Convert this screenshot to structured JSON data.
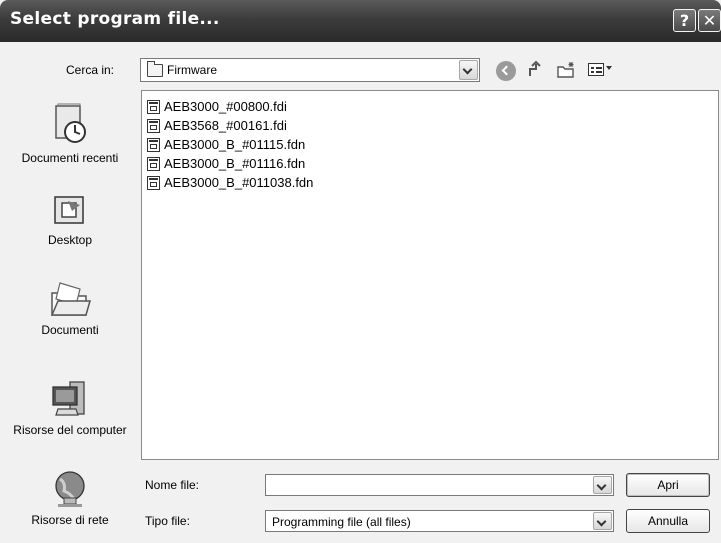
{
  "window": {
    "title": "Select program file...",
    "help_glyph": "?",
    "close_glyph": "✕"
  },
  "lookin": {
    "label": "Cerca in:",
    "value": "Firmware"
  },
  "toolbar": {
    "icons": [
      "back-icon",
      "up-folder-icon",
      "new-folder-icon",
      "views-menu-icon"
    ]
  },
  "places": [
    {
      "label": "Documenti recenti",
      "icon": "recent-documents-icon"
    },
    {
      "label": "Desktop",
      "icon": "desktop-icon"
    },
    {
      "label": "Documenti",
      "icon": "documents-icon"
    },
    {
      "label": "Risorse del computer",
      "icon": "my-computer-icon"
    },
    {
      "label": "Risorse di rete",
      "icon": "network-icon"
    }
  ],
  "files": [
    "AEB3000_#00800.fdi",
    "AEB3568_#00161.fdi",
    "AEB3000_B_#01115.fdn",
    "AEB3000_B_#01116.fdn",
    "AEB3000_B_#011038.fdn"
  ],
  "filename": {
    "label": "Nome file:",
    "value": ""
  },
  "filetype": {
    "label": "Tipo file:",
    "value": "Programming file (all files)"
  },
  "buttons": {
    "open": "Apri",
    "cancel": "Annulla"
  }
}
